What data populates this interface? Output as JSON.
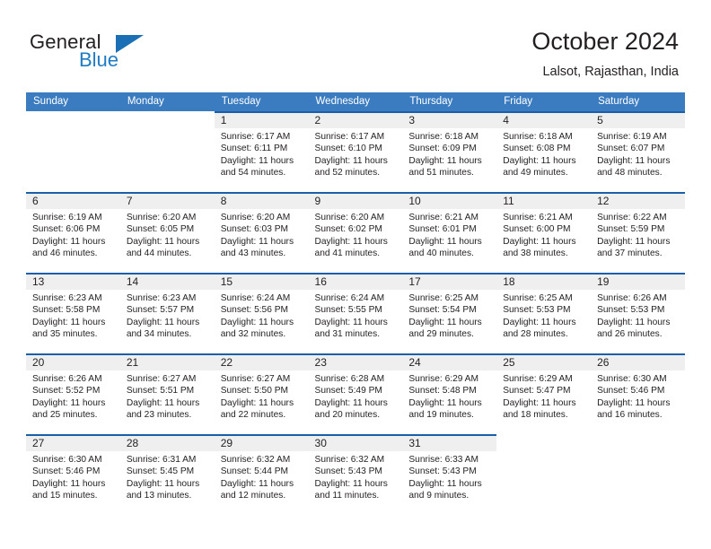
{
  "brand": {
    "name_part1": "General",
    "name_part2": "Blue",
    "flag_icon": "blue-triangle-flag-icon"
  },
  "header": {
    "title": "October 2024",
    "subtitle": "Lalsot, Rajasthan, India"
  },
  "colors": {
    "header_blue": "#3b7cc0",
    "separator_blue": "#1a5fa8",
    "day_band_gray": "#efefef",
    "brand_blue": "#1e7bc4",
    "text": "#231f20"
  },
  "weekdays": [
    "Sunday",
    "Monday",
    "Tuesday",
    "Wednesday",
    "Thursday",
    "Friday",
    "Saturday"
  ],
  "weeks": [
    [
      {
        "day": "",
        "sunrise": "",
        "sunset": "",
        "daylight_line1": "",
        "daylight_line2": ""
      },
      {
        "day": "",
        "sunrise": "",
        "sunset": "",
        "daylight_line1": "",
        "daylight_line2": ""
      },
      {
        "day": "1",
        "sunrise": "Sunrise: 6:17 AM",
        "sunset": "Sunset: 6:11 PM",
        "daylight_line1": "Daylight: 11 hours",
        "daylight_line2": "and 54 minutes."
      },
      {
        "day": "2",
        "sunrise": "Sunrise: 6:17 AM",
        "sunset": "Sunset: 6:10 PM",
        "daylight_line1": "Daylight: 11 hours",
        "daylight_line2": "and 52 minutes."
      },
      {
        "day": "3",
        "sunrise": "Sunrise: 6:18 AM",
        "sunset": "Sunset: 6:09 PM",
        "daylight_line1": "Daylight: 11 hours",
        "daylight_line2": "and 51 minutes."
      },
      {
        "day": "4",
        "sunrise": "Sunrise: 6:18 AM",
        "sunset": "Sunset: 6:08 PM",
        "daylight_line1": "Daylight: 11 hours",
        "daylight_line2": "and 49 minutes."
      },
      {
        "day": "5",
        "sunrise": "Sunrise: 6:19 AM",
        "sunset": "Sunset: 6:07 PM",
        "daylight_line1": "Daylight: 11 hours",
        "daylight_line2": "and 48 minutes."
      }
    ],
    [
      {
        "day": "6",
        "sunrise": "Sunrise: 6:19 AM",
        "sunset": "Sunset: 6:06 PM",
        "daylight_line1": "Daylight: 11 hours",
        "daylight_line2": "and 46 minutes."
      },
      {
        "day": "7",
        "sunrise": "Sunrise: 6:20 AM",
        "sunset": "Sunset: 6:05 PM",
        "daylight_line1": "Daylight: 11 hours",
        "daylight_line2": "and 44 minutes."
      },
      {
        "day": "8",
        "sunrise": "Sunrise: 6:20 AM",
        "sunset": "Sunset: 6:03 PM",
        "daylight_line1": "Daylight: 11 hours",
        "daylight_line2": "and 43 minutes."
      },
      {
        "day": "9",
        "sunrise": "Sunrise: 6:20 AM",
        "sunset": "Sunset: 6:02 PM",
        "daylight_line1": "Daylight: 11 hours",
        "daylight_line2": "and 41 minutes."
      },
      {
        "day": "10",
        "sunrise": "Sunrise: 6:21 AM",
        "sunset": "Sunset: 6:01 PM",
        "daylight_line1": "Daylight: 11 hours",
        "daylight_line2": "and 40 minutes."
      },
      {
        "day": "11",
        "sunrise": "Sunrise: 6:21 AM",
        "sunset": "Sunset: 6:00 PM",
        "daylight_line1": "Daylight: 11 hours",
        "daylight_line2": "and 38 minutes."
      },
      {
        "day": "12",
        "sunrise": "Sunrise: 6:22 AM",
        "sunset": "Sunset: 5:59 PM",
        "daylight_line1": "Daylight: 11 hours",
        "daylight_line2": "and 37 minutes."
      }
    ],
    [
      {
        "day": "13",
        "sunrise": "Sunrise: 6:23 AM",
        "sunset": "Sunset: 5:58 PM",
        "daylight_line1": "Daylight: 11 hours",
        "daylight_line2": "and 35 minutes."
      },
      {
        "day": "14",
        "sunrise": "Sunrise: 6:23 AM",
        "sunset": "Sunset: 5:57 PM",
        "daylight_line1": "Daylight: 11 hours",
        "daylight_line2": "and 34 minutes."
      },
      {
        "day": "15",
        "sunrise": "Sunrise: 6:24 AM",
        "sunset": "Sunset: 5:56 PM",
        "daylight_line1": "Daylight: 11 hours",
        "daylight_line2": "and 32 minutes."
      },
      {
        "day": "16",
        "sunrise": "Sunrise: 6:24 AM",
        "sunset": "Sunset: 5:55 PM",
        "daylight_line1": "Daylight: 11 hours",
        "daylight_line2": "and 31 minutes."
      },
      {
        "day": "17",
        "sunrise": "Sunrise: 6:25 AM",
        "sunset": "Sunset: 5:54 PM",
        "daylight_line1": "Daylight: 11 hours",
        "daylight_line2": "and 29 minutes."
      },
      {
        "day": "18",
        "sunrise": "Sunrise: 6:25 AM",
        "sunset": "Sunset: 5:53 PM",
        "daylight_line1": "Daylight: 11 hours",
        "daylight_line2": "and 28 minutes."
      },
      {
        "day": "19",
        "sunrise": "Sunrise: 6:26 AM",
        "sunset": "Sunset: 5:53 PM",
        "daylight_line1": "Daylight: 11 hours",
        "daylight_line2": "and 26 minutes."
      }
    ],
    [
      {
        "day": "20",
        "sunrise": "Sunrise: 6:26 AM",
        "sunset": "Sunset: 5:52 PM",
        "daylight_line1": "Daylight: 11 hours",
        "daylight_line2": "and 25 minutes."
      },
      {
        "day": "21",
        "sunrise": "Sunrise: 6:27 AM",
        "sunset": "Sunset: 5:51 PM",
        "daylight_line1": "Daylight: 11 hours",
        "daylight_line2": "and 23 minutes."
      },
      {
        "day": "22",
        "sunrise": "Sunrise: 6:27 AM",
        "sunset": "Sunset: 5:50 PM",
        "daylight_line1": "Daylight: 11 hours",
        "daylight_line2": "and 22 minutes."
      },
      {
        "day": "23",
        "sunrise": "Sunrise: 6:28 AM",
        "sunset": "Sunset: 5:49 PM",
        "daylight_line1": "Daylight: 11 hours",
        "daylight_line2": "and 20 minutes."
      },
      {
        "day": "24",
        "sunrise": "Sunrise: 6:29 AM",
        "sunset": "Sunset: 5:48 PM",
        "daylight_line1": "Daylight: 11 hours",
        "daylight_line2": "and 19 minutes."
      },
      {
        "day": "25",
        "sunrise": "Sunrise: 6:29 AM",
        "sunset": "Sunset: 5:47 PM",
        "daylight_line1": "Daylight: 11 hours",
        "daylight_line2": "and 18 minutes."
      },
      {
        "day": "26",
        "sunrise": "Sunrise: 6:30 AM",
        "sunset": "Sunset: 5:46 PM",
        "daylight_line1": "Daylight: 11 hours",
        "daylight_line2": "and 16 minutes."
      }
    ],
    [
      {
        "day": "27",
        "sunrise": "Sunrise: 6:30 AM",
        "sunset": "Sunset: 5:46 PM",
        "daylight_line1": "Daylight: 11 hours",
        "daylight_line2": "and 15 minutes."
      },
      {
        "day": "28",
        "sunrise": "Sunrise: 6:31 AM",
        "sunset": "Sunset: 5:45 PM",
        "daylight_line1": "Daylight: 11 hours",
        "daylight_line2": "and 13 minutes."
      },
      {
        "day": "29",
        "sunrise": "Sunrise: 6:32 AM",
        "sunset": "Sunset: 5:44 PM",
        "daylight_line1": "Daylight: 11 hours",
        "daylight_line2": "and 12 minutes."
      },
      {
        "day": "30",
        "sunrise": "Sunrise: 6:32 AM",
        "sunset": "Sunset: 5:43 PM",
        "daylight_line1": "Daylight: 11 hours",
        "daylight_line2": "and 11 minutes."
      },
      {
        "day": "31",
        "sunrise": "Sunrise: 6:33 AM",
        "sunset": "Sunset: 5:43 PM",
        "daylight_line1": "Daylight: 11 hours",
        "daylight_line2": "and 9 minutes."
      },
      {
        "day": "",
        "sunrise": "",
        "sunset": "",
        "daylight_line1": "",
        "daylight_line2": ""
      },
      {
        "day": "",
        "sunrise": "",
        "sunset": "",
        "daylight_line1": "",
        "daylight_line2": ""
      }
    ]
  ]
}
